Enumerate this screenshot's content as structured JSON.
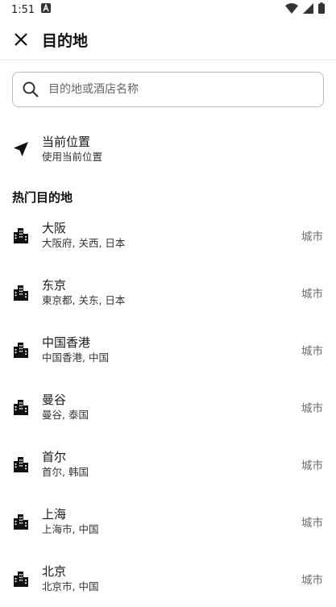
{
  "status_bar": {
    "time": "1:51"
  },
  "header": {
    "title": "目的地"
  },
  "search": {
    "placeholder": "目的地或酒店名称"
  },
  "current_location": {
    "title": "当前位置",
    "subtitle": "使用当前位置"
  },
  "popular": {
    "heading": "热门目的地",
    "items": [
      {
        "name": "大阪",
        "detail": "大阪府, 关西, 日本",
        "type": "城市"
      },
      {
        "name": "东京",
        "detail": "東京都, 关东, 日本",
        "type": "城市"
      },
      {
        "name": "中国香港",
        "detail": "中国香港, 中国",
        "type": "城市"
      },
      {
        "name": "曼谷",
        "detail": "曼谷, 泰国",
        "type": "城市"
      },
      {
        "name": "首尔",
        "detail": "首尔, 韩国",
        "type": "城市"
      },
      {
        "name": "上海",
        "detail": "上海市, 中国",
        "type": "城市"
      },
      {
        "name": "北京",
        "detail": "北京市, 中国",
        "type": "城市"
      }
    ]
  }
}
